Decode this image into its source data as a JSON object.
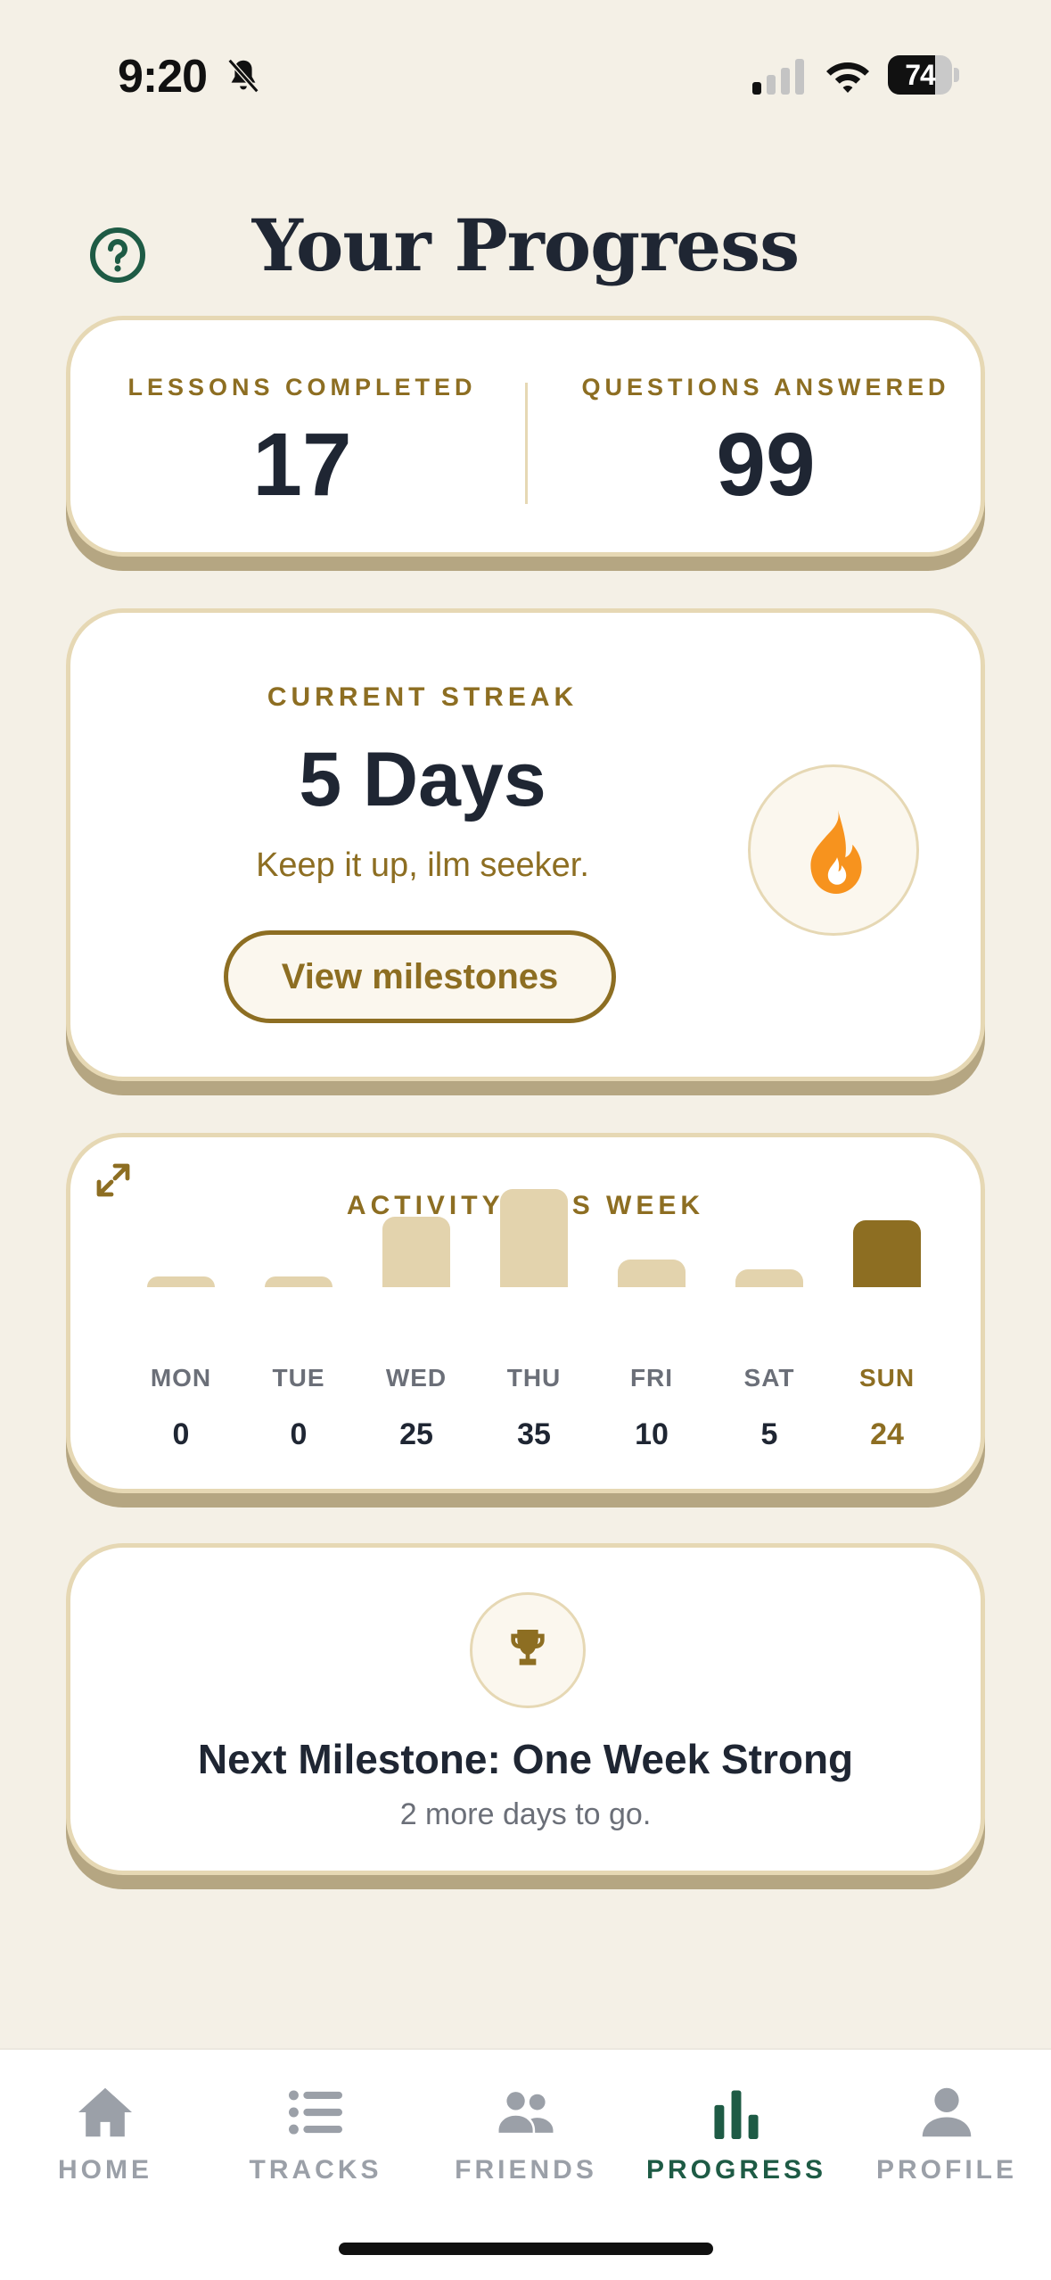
{
  "status_bar": {
    "time": "9:20",
    "battery_level": "74",
    "battery_fraction": 0.74,
    "icons": [
      "bell-slash-icon",
      "cellular-signal-icon",
      "wifi-icon",
      "battery-icon"
    ]
  },
  "header": {
    "title": "Your Progress",
    "help_icon": "question-circle-icon"
  },
  "stats": {
    "lessons_label": "LESSONS COMPLETED",
    "lessons_value": "17",
    "questions_label": "QUESTIONS ANSWERED",
    "questions_value": "99"
  },
  "streak": {
    "label": "CURRENT STREAK",
    "value": "5 Days",
    "message": "Keep it up, ilm seeker.",
    "button_label": "View milestones",
    "icon": "flame-icon"
  },
  "activity": {
    "title": "ACTIVITY THIS WEEK",
    "expand_icon": "expand-icon",
    "today_index": 6,
    "days": [
      {
        "label": "MON",
        "value": "0"
      },
      {
        "label": "TUE",
        "value": "0"
      },
      {
        "label": "WED",
        "value": "25"
      },
      {
        "label": "THU",
        "value": "35"
      },
      {
        "label": "FRI",
        "value": "10"
      },
      {
        "label": "SAT",
        "value": "5"
      },
      {
        "label": "SUN",
        "value": "24"
      }
    ]
  },
  "milestone": {
    "title": "Next Milestone: One Week Strong",
    "subtitle": "2 more days to go.",
    "icon": "trophy-icon"
  },
  "tabs": [
    {
      "label": "HOME",
      "icon": "home-icon",
      "active": false
    },
    {
      "label": "TRACKS",
      "icon": "list-icon",
      "active": false
    },
    {
      "label": "FRIENDS",
      "icon": "people-icon",
      "active": false
    },
    {
      "label": "PROGRESS",
      "icon": "bar-chart-icon",
      "active": true
    },
    {
      "label": "PROFILE",
      "icon": "person-icon",
      "active": false
    }
  ],
  "colors": {
    "background": "#F4F0E6",
    "accent_gold": "#8D6E22",
    "bar_light": "#E3D3AD",
    "active_tab": "#1E5B45",
    "inactive_tab": "#9BA0A8",
    "flame": "#F7931E"
  }
}
